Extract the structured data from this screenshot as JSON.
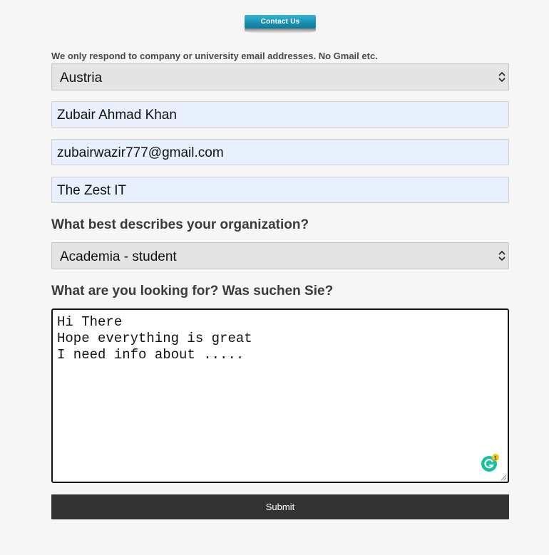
{
  "header": {
    "logo_text": "Contact Us"
  },
  "form": {
    "notice": "We only respond to company or university email addresses. No Gmail etc.",
    "country": {
      "selected": "Austria"
    },
    "name": {
      "value": "Zubair Ahmad Khan"
    },
    "email": {
      "value": "zubairwazir777@gmail.com"
    },
    "company": {
      "value": "The Zest IT"
    },
    "organization": {
      "label": "What best describes your organization?",
      "selected": "Academia - student"
    },
    "looking_for": {
      "label": "What are you looking for? Was suchen Sie?",
      "lines": [
        "Hi There",
        "Hope everything is great",
        "I need info about ....."
      ]
    },
    "grammarly_badge": {
      "icon": "grammarly-icon",
      "count": "1"
    },
    "submit_label": "Submit"
  },
  "colors": {
    "background": "#f6f6f6",
    "select_bg": "#e4e4e4",
    "autofill_bg": "#e8f0fe",
    "submit_bg": "#333333",
    "logo_blue": "#1a8fb1",
    "grammarly_green": "#15c39a",
    "badge_yellow": "#f5c518"
  }
}
